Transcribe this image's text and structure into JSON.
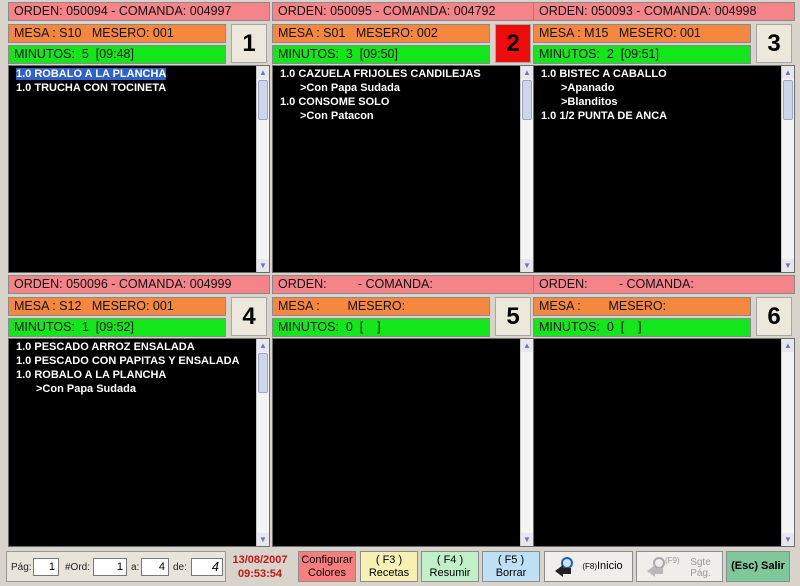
{
  "panels": [
    {
      "orden": "ORDEN: 050094 - COMANDA: 004997",
      "mesa": "MESA : S10   MESERO: 001",
      "minutos": "MINUTOS:  5  [09:48]",
      "number": "1",
      "alert": false,
      "items": [
        {
          "qty": "1.0",
          "text": "ROBALO A LA PLANCHA",
          "sub": false,
          "selected": true
        },
        {
          "qty": "1.0",
          "text": "TRUCHA CON TOCINETA",
          "sub": false,
          "selected": false
        }
      ]
    },
    {
      "orden": "ORDEN: 050095 - COMANDA: 004792",
      "mesa": "MESA : S01   MESERO: 002",
      "minutos": "MINUTOS:  3  [09:50]",
      "number": "2",
      "alert": true,
      "items": [
        {
          "qty": "1.0",
          "text": "CAZUELA FRIJOLES CANDILEJAS",
          "sub": false,
          "selected": false
        },
        {
          "qty": "",
          "text": ">Con Papa Sudada",
          "sub": true,
          "selected": false
        },
        {
          "qty": "1.0",
          "text": "CONSOME SOLO",
          "sub": false,
          "selected": false
        },
        {
          "qty": "",
          "text": ">Con Patacon",
          "sub": true,
          "selected": false
        }
      ]
    },
    {
      "orden": "ORDEN: 050093 - COMANDA: 004998",
      "mesa": "MESA : M15   MESERO: 001",
      "minutos": "MINUTOS:  2  [09:51]",
      "number": "3",
      "alert": false,
      "items": [
        {
          "qty": "1.0",
          "text": "BISTEC A CABALLO",
          "sub": false,
          "selected": false
        },
        {
          "qty": "",
          "text": ">Apanado",
          "sub": true,
          "selected": false
        },
        {
          "qty": "",
          "text": ">Blanditos",
          "sub": true,
          "selected": false
        },
        {
          "qty": "1.0",
          "text": "1/2 PUNTA DE ANCA",
          "sub": false,
          "selected": false
        }
      ]
    },
    {
      "orden": "ORDEN: 050096 - COMANDA: 004999",
      "mesa": "MESA : S12   MESERO: 001",
      "minutos": "MINUTOS:  1  [09:52]",
      "number": "4",
      "alert": false,
      "items": [
        {
          "qty": "1.0",
          "text": "PESCADO ARROZ ENSALADA",
          "sub": false,
          "selected": false
        },
        {
          "qty": "1.0",
          "text": "PESCADO CON PAPITAS Y ENSALADA",
          "sub": false,
          "selected": false
        },
        {
          "qty": "1.0",
          "text": "ROBALO A LA PLANCHA",
          "sub": false,
          "selected": false
        },
        {
          "qty": "",
          "text": ">Con Papa Sudada",
          "sub": true,
          "selected": false
        }
      ]
    },
    {
      "orden": "ORDEN:         - COMANDA:",
      "mesa": "MESA :        MESERO:",
      "minutos": "MINUTOS:  0  [    ]",
      "number": "5",
      "alert": false,
      "items": []
    },
    {
      "orden": "ORDEN:         - COMANDA:",
      "mesa": "MESA :        MESERO:",
      "minutos": "MINUTOS:  0  [    ]",
      "number": "6",
      "alert": false,
      "items": []
    }
  ],
  "pager": {
    "pag_label": "Pág:",
    "pag_value": "1",
    "ord_label": "#Ord:",
    "ord_value": "1",
    "a_label": "a:",
    "a_value": "4",
    "de_label": "de:",
    "de_value": "4"
  },
  "datetime": {
    "date": "13/08/2007",
    "time": "09:53:54"
  },
  "buttons": {
    "colores_line1": "Configurar",
    "colores_line2": "Colores",
    "recetas_key": "( F3 )",
    "recetas_label": "Recetas",
    "resumir_key": "( F4 )",
    "resumir_label": "Resumir",
    "borrar_key": "( F5 )",
    "borrar_label": "Borrar",
    "inicio_key": "(F8)",
    "inicio_label": "Inicio",
    "sgte_key": "(F9)",
    "sgte_line1": "Sgte",
    "sgte_line2": "Pág.",
    "salir_label": "(Esc)  Salir"
  },
  "colors": {
    "orden_bg": "#f4848a",
    "mesa_bg": "#f5873f",
    "minutos_bg": "#13e61a",
    "alert": "#ee0c0c",
    "list_bg": "#000000",
    "date_text": "#c11818"
  },
  "icons": {
    "inicio": "arrow-home-search-icon",
    "sgte": "arrow-next-search-icon",
    "scroll_up": "chevron-up-icon",
    "scroll_down": "chevron-down-icon"
  }
}
